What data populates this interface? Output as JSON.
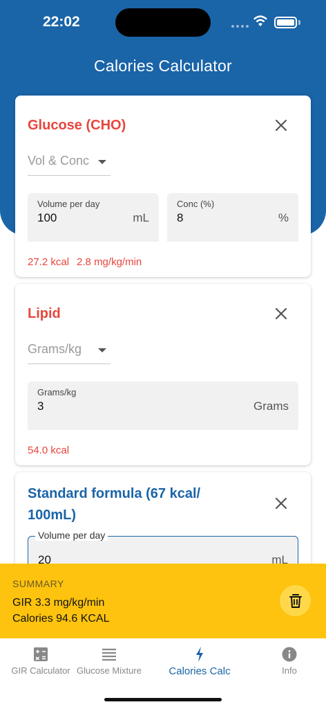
{
  "status": {
    "time": "22:02"
  },
  "app": {
    "title": "Calories Calculator"
  },
  "cards": {
    "glucose": {
      "title": "Glucose (CHO)",
      "mode": "Vol & Conc",
      "volume": {
        "label": "Volume per day",
        "value": "100",
        "suffix": "mL"
      },
      "conc": {
        "label": "Conc (%)",
        "value": "8",
        "suffix": "%"
      },
      "result_kcal": "27.2 kcal",
      "result_gir": "2.8 mg/kg/min"
    },
    "lipid": {
      "title": "Lipid",
      "mode": "Grams/kg",
      "grams": {
        "label": "Grams/kg",
        "value": "3",
        "suffix": "Grams"
      },
      "result_kcal": "54.0 kcal"
    },
    "formula": {
      "title_line1": "Standard formula (67 kcal/",
      "title_line2": "100mL)",
      "volume": {
        "label": "Volume per day",
        "value": "20",
        "suffix": "mL"
      }
    }
  },
  "summary": {
    "heading": "SUMMARY",
    "gir": "GIR 3.3 mg/kg/min",
    "calories": "Calories 94.6 KCAL"
  },
  "tabs": [
    {
      "label": "GIR Calculator",
      "icon": "calculator-icon",
      "active": false
    },
    {
      "label": "Glucose Mixture",
      "icon": "list-icon",
      "active": false
    },
    {
      "label": "Calories Calc",
      "icon": "lightning-icon",
      "active": true
    },
    {
      "label": "Info",
      "icon": "info-icon",
      "active": false
    }
  ],
  "colors": {
    "primary": "#1a64a8",
    "accent_red": "#e8453c",
    "summary_bg": "#fdc30e"
  }
}
